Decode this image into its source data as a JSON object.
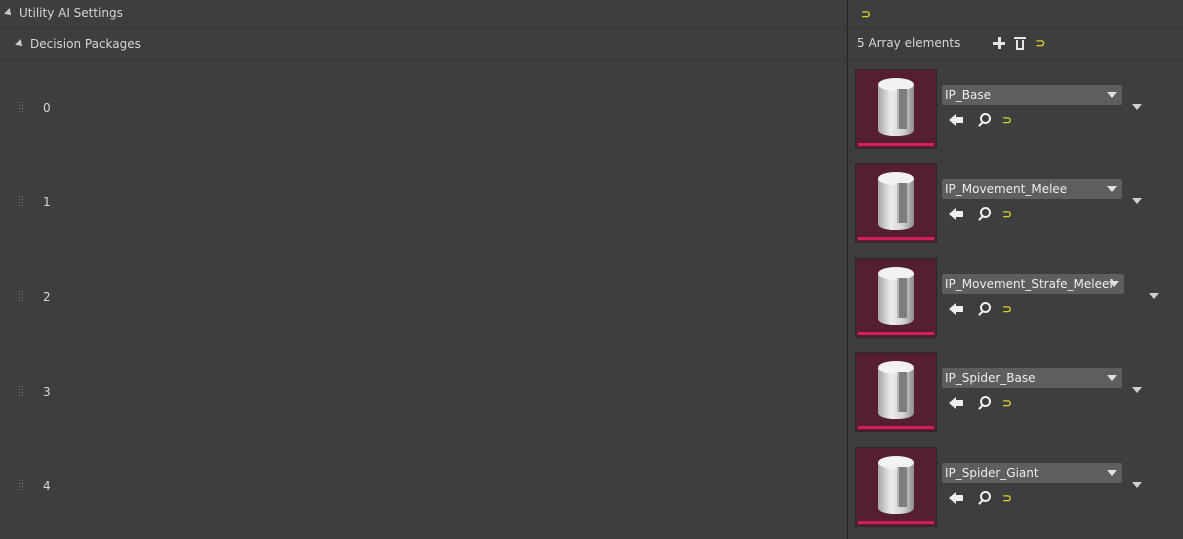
{
  "category": {
    "title": "Utility AI Settings",
    "reset_icon": "reset-to-default-icon"
  },
  "property": {
    "name": "Decision Packages",
    "count_label": "5 Array elements",
    "add_icon": "plus-icon",
    "clear_icon": "trash-icon"
  },
  "elements": [
    {
      "index": "0",
      "asset": "IP_Base"
    },
    {
      "index": "1",
      "asset": "IP_Movement_Melee"
    },
    {
      "index": "2",
      "asset": "IP_Movement_Strafe_MeleeMid"
    },
    {
      "index": "3",
      "asset": "IP_Spider_Base"
    },
    {
      "index": "4",
      "asset": "IP_Spider_Giant"
    }
  ],
  "colors": {
    "background": "#3e3e3e",
    "thumbnail": "#561f31",
    "thumbnail_accent": "#d21e5a",
    "reset_yellow": "#d4d42c"
  },
  "reset_glyph": "⊃"
}
